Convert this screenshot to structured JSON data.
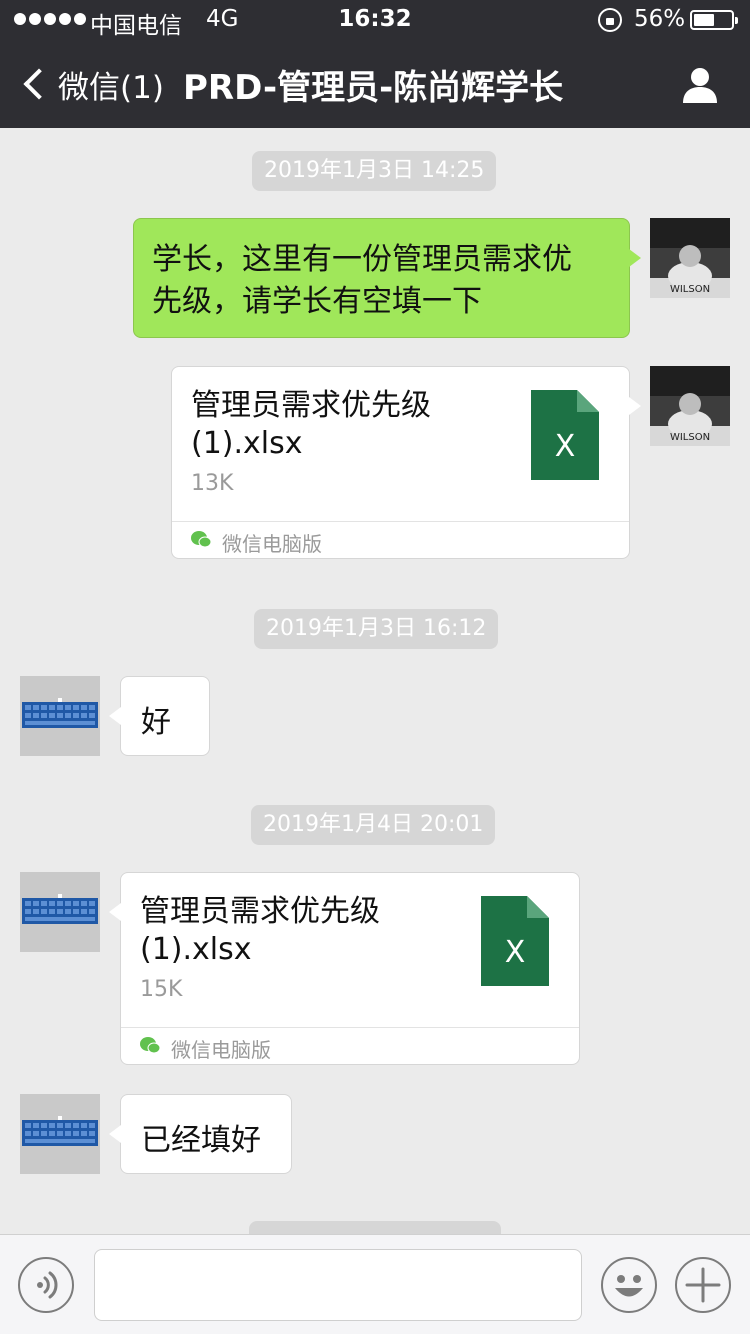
{
  "status_bar": {
    "carrier": "中国电信",
    "network": "4G",
    "time": "16:32",
    "battery_percent": "56%",
    "battery_level": 0.56
  },
  "nav": {
    "back_label": "微信(1)",
    "title": "PRD-管理员-陈尚辉学长",
    "profile_icon": "person-icon"
  },
  "messages": {
    "ts1": "2019年1月3日 14:25",
    "msg1": {
      "line1": "学长，这里有一份管理员需求优",
      "line2": "先级，请学长有空填一下"
    },
    "file1": {
      "name": "管理员需求优先级\n(1).xlsx",
      "size": "13K",
      "source": "微信电脑版",
      "icon_letter": "X"
    },
    "ts2": "2019年1月3日 16:12",
    "msg2": "好",
    "ts3": "2019年1月4日 20:01",
    "file2": {
      "name": "管理员需求优先级\n(1).xlsx",
      "size": "15K",
      "source": "微信电脑版",
      "icon_letter": "X"
    },
    "msg3": "已经填好"
  },
  "input_bar": {
    "voice_icon": "voice-icon",
    "input_value": "",
    "emoji_icon": "emoji-icon",
    "plus_icon": "plus-icon"
  },
  "colors": {
    "nav_bg": "#2e2e33",
    "chat_bg": "#ebebeb",
    "sent_bubble": "#a0e75a",
    "excel_green": "#1d7245"
  }
}
